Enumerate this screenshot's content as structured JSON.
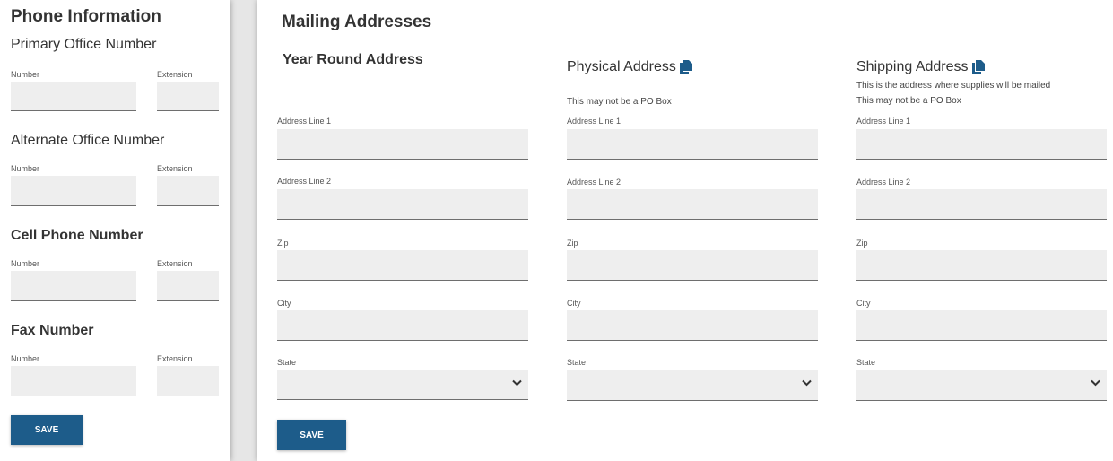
{
  "phone": {
    "title": "Phone Information",
    "sections": [
      {
        "title": "Primary Office Number",
        "number_label": "Number",
        "extension_label": "Extension"
      },
      {
        "title": "Alternate Office Number",
        "number_label": "Number",
        "extension_label": "Extension"
      },
      {
        "title": "Cell Phone Number",
        "number_label": "Number",
        "extension_label": "Extension"
      },
      {
        "title": "Fax Number",
        "number_label": "Number",
        "extension_label": "Extension"
      }
    ],
    "save_label": "SAVE"
  },
  "mailing": {
    "title": "Mailing Addresses",
    "columns": [
      {
        "title": "Year Round Address",
        "notes": [],
        "copy_icon": "",
        "labels": {
          "line1": "Address Line 1",
          "line2": "Address Line 2",
          "zip": "Zip",
          "city": "City",
          "state": "State"
        }
      },
      {
        "title": "Physical Address",
        "notes": [
          "This may not be a PO Box"
        ],
        "copy_icon": "copy-icon",
        "labels": {
          "line1": "Address Line 1",
          "line2": "Address Line 2",
          "zip": "Zip",
          "city": "City",
          "state": "State"
        }
      },
      {
        "title": "Shipping Address",
        "notes": [
          "This is the address where supplies will be mailed",
          "This may not be a PO Box"
        ],
        "copy_icon": "copy-icon",
        "labels": {
          "line1": "Address Line 1",
          "line2": "Address Line 2",
          "zip": "Zip",
          "city": "City",
          "state": "State"
        }
      }
    ],
    "save_label": "SAVE"
  },
  "colors": {
    "accent": "#1d5c8a",
    "field_bg": "#eeeeee"
  }
}
